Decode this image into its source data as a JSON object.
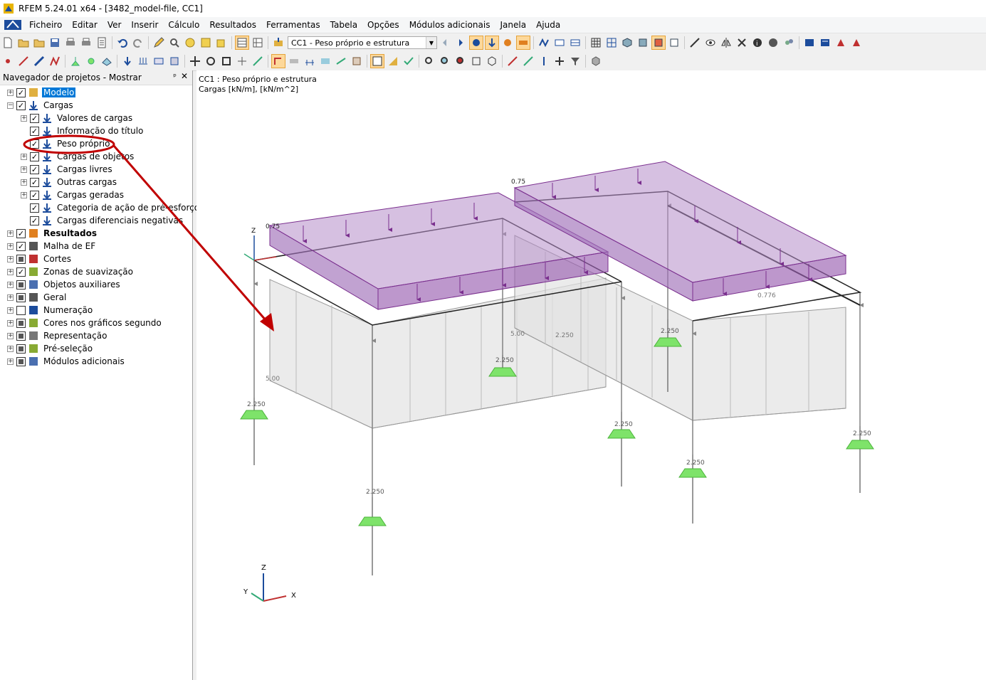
{
  "window": {
    "title": "RFEM 5.24.01 x64 - [3482_model-file, CC1]"
  },
  "menu": [
    "Ficheiro",
    "Editar",
    "Ver",
    "Inserir",
    "Cálculo",
    "Resultados",
    "Ferramentas",
    "Tabela",
    "Opções",
    "Módulos adicionais",
    "Janela",
    "Ajuda"
  ],
  "toolbar": {
    "load_case": "CC1 - Peso próprio e estrutura"
  },
  "navigator": {
    "title": "Navegador de projetos - Mostrar",
    "pin": "ᵖ",
    "close": "✕",
    "tree": [
      {
        "label": "Modelo",
        "level": 0,
        "expand": "+",
        "check": "checked",
        "icon": "model-icon",
        "selected": true
      },
      {
        "label": "Cargas",
        "level": 0,
        "expand": "−",
        "check": "checked",
        "icon": "load-icon"
      },
      {
        "label": "Valores de cargas",
        "level": 1,
        "expand": "+",
        "check": "checked",
        "icon": "load-icon"
      },
      {
        "label": "Informação do título",
        "level": 1,
        "expand": "",
        "check": "checked",
        "icon": "load-icon"
      },
      {
        "label": "Peso próprio",
        "level": 1,
        "expand": "",
        "check": "checked",
        "icon": "load-icon"
      },
      {
        "label": "Cargas de objetos",
        "level": 1,
        "expand": "+",
        "check": "checked",
        "icon": "load-icon"
      },
      {
        "label": "Cargas livres",
        "level": 1,
        "expand": "+",
        "check": "checked",
        "icon": "load-icon"
      },
      {
        "label": "Outras cargas",
        "level": 1,
        "expand": "+",
        "check": "checked",
        "icon": "load-icon"
      },
      {
        "label": "Cargas geradas",
        "level": 1,
        "expand": "+",
        "check": "checked",
        "icon": "load-icon"
      },
      {
        "label": "Categoria de ação de pré-esforço",
        "level": 1,
        "expand": "",
        "check": "checked",
        "icon": "load-icon"
      },
      {
        "label": "Cargas diferenciais negativas",
        "level": 1,
        "expand": "",
        "check": "checked",
        "icon": "load-icon"
      },
      {
        "label": "Resultados",
        "level": 0,
        "expand": "+",
        "check": "checked",
        "icon": "results-icon",
        "bold": true
      },
      {
        "label": "Malha de EF",
        "level": 0,
        "expand": "+",
        "check": "checked",
        "icon": "mesh-icon"
      },
      {
        "label": "Cortes",
        "level": 0,
        "expand": "+",
        "check": "partial",
        "icon": "section-icon"
      },
      {
        "label": "Zonas de suavização",
        "level": 0,
        "expand": "+",
        "check": "checked",
        "icon": "smoothing-icon"
      },
      {
        "label": "Objetos auxiliares",
        "level": 0,
        "expand": "+",
        "check": "partial",
        "icon": "auxiliary-icon"
      },
      {
        "label": "Geral",
        "level": 0,
        "expand": "+",
        "check": "partial",
        "icon": "general-icon"
      },
      {
        "label": "Numeração",
        "level": 0,
        "expand": "+",
        "check": "unchecked",
        "icon": "numbering-icon"
      },
      {
        "label": "Cores nos gráficos segundo",
        "level": 0,
        "expand": "+",
        "check": "partial",
        "icon": "colors-icon"
      },
      {
        "label": "Representação",
        "level": 0,
        "expand": "+",
        "check": "partial",
        "icon": "display-icon"
      },
      {
        "label": "Pré-seleção",
        "level": 0,
        "expand": "+",
        "check": "partial",
        "icon": "preselection-icon"
      },
      {
        "label": "Módulos adicionais",
        "level": 0,
        "expand": "+",
        "check": "partial",
        "icon": "addon-icon"
      }
    ]
  },
  "viewport": {
    "line1": "CC1 : Peso próprio e estrutura",
    "line2": "Cargas [kN/m], [kN/m^2]",
    "values": {
      "slab_load_left": "0.75",
      "slab_load_right": "0.75",
      "wall_load_left": "5.00",
      "wall_load_right": "5.00",
      "edge_value": "0.776",
      "support_reaction": "2.250",
      "wall_middle": "2.250"
    },
    "axes": {
      "x": "X",
      "y": "Y",
      "z": "Z"
    }
  },
  "colors": {
    "load": "#7a2f8e",
    "support": "#7ee36a",
    "annotation": "#c00000",
    "selection": "#0078d7"
  }
}
